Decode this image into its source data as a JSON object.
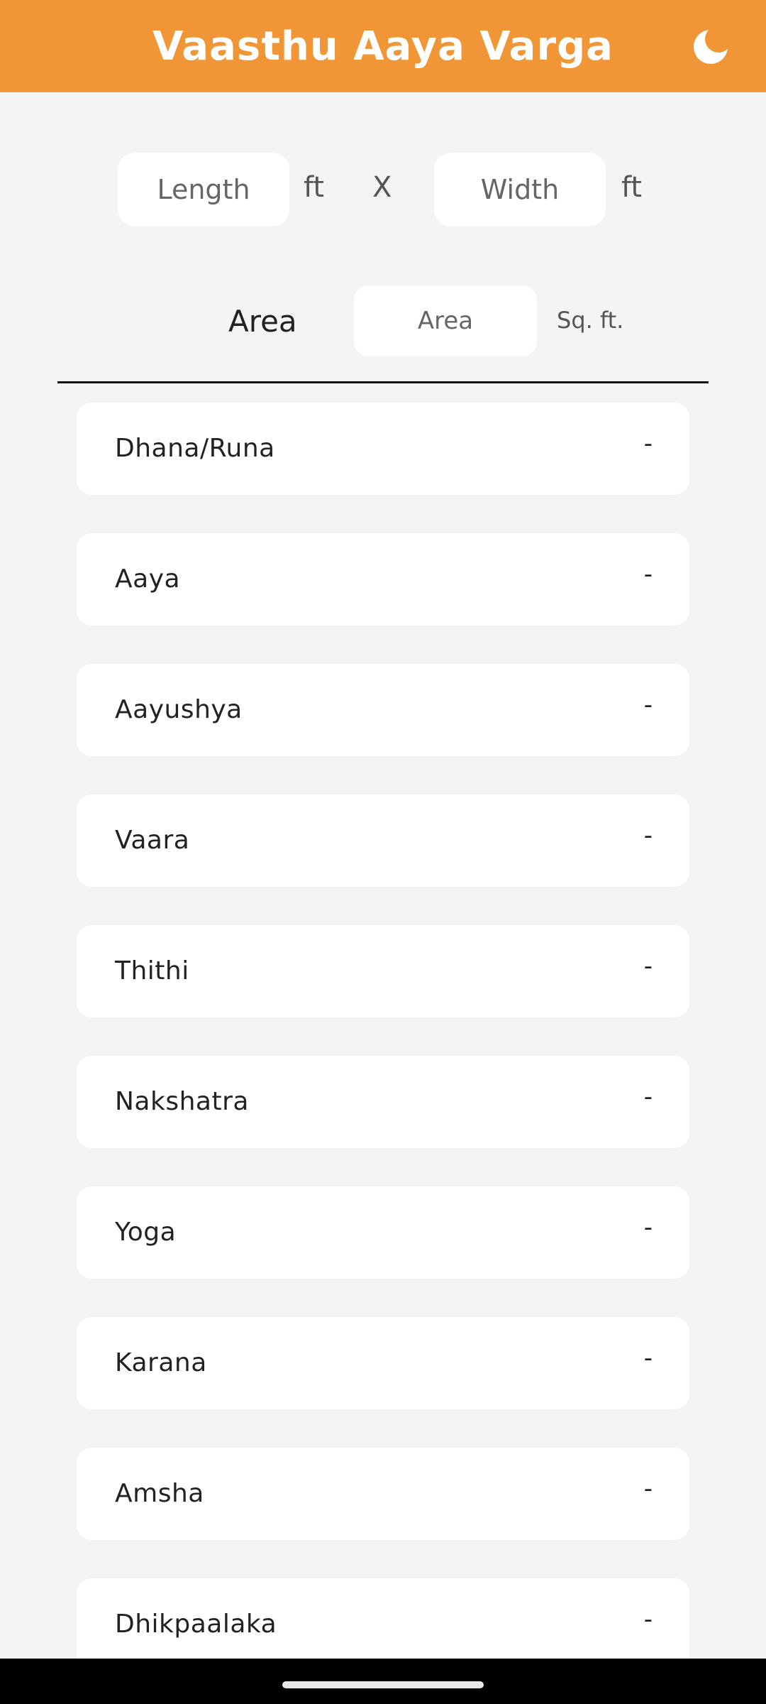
{
  "app_bar": {
    "title": "Vaasthu Aaya Varga",
    "theme_icon": "moon-icon",
    "color": "#f09637"
  },
  "dimensions": {
    "length_placeholder": "Length",
    "width_placeholder": "Width",
    "unit": "ft",
    "separator": "X"
  },
  "area": {
    "label": "Area",
    "placeholder": "Area",
    "unit": "Sq. ft."
  },
  "results": [
    {
      "name": "Dhana/Runa",
      "value": "-"
    },
    {
      "name": "Aaya",
      "value": "-"
    },
    {
      "name": "Aayushya",
      "value": "-"
    },
    {
      "name": "Vaara",
      "value": "-"
    },
    {
      "name": "Thithi",
      "value": "-"
    },
    {
      "name": "Nakshatra",
      "value": "-"
    },
    {
      "name": "Yoga",
      "value": "-"
    },
    {
      "name": "Karana",
      "value": "-"
    },
    {
      "name": "Amsha",
      "value": "-"
    },
    {
      "name": "Dhikpaalaka",
      "value": "-"
    }
  ]
}
